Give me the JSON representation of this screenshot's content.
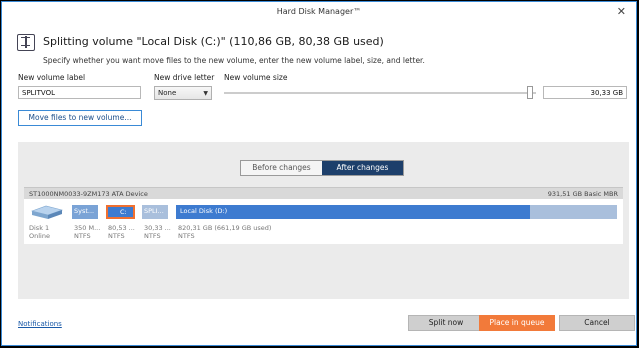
{
  "window": {
    "title": "Hard Disk Manager™",
    "close_glyph": "✕"
  },
  "header": {
    "icon": "split-volume-icon",
    "headline": "Splitting volume \"Local Disk (C:)\" (110,86 GB, 80,38 GB used)",
    "subline": "Specify whether you want move files to the new volume, enter the new volume label, size, and letter."
  },
  "form": {
    "label_label": "New volume label",
    "label_value": "SPLITVOL",
    "letter_label": "New drive letter",
    "letter_value": "None",
    "size_label": "New volume size",
    "size_value": "30,33 GB",
    "move_button": "Move files to new volume..."
  },
  "view_toggle": {
    "before": "Before changes",
    "after": "After changes",
    "active": "after"
  },
  "disk": {
    "model": "ST1000NM0033-9ZM173 ATA Device",
    "info": "931,51 GB Basic MBR",
    "name": "Disk 1",
    "state": "Online",
    "partitions": [
      {
        "label": "Syst...",
        "size": "350 M...",
        "fs": "NTFS"
      },
      {
        "label": "C:",
        "size": "80,53 ...",
        "fs": "NTFS"
      },
      {
        "label": "SPLI...",
        "size": "30,33 ...",
        "fs": "NTFS"
      },
      {
        "label": "Local Disk (D:)",
        "size": "820,31 GB (661,19 GB used)",
        "fs": "NTFS"
      }
    ]
  },
  "footer": {
    "notifications": "Notifications",
    "split_now": "Split now",
    "place_in_queue": "Place in queue",
    "cancel": "Cancel"
  },
  "colors": {
    "accent": "#3a8ad6",
    "partition_selected": "#3d7bd0",
    "selection_border": "#f07030",
    "toggle_active": "#1d3f6b",
    "queue_button": "#f27a3a"
  }
}
